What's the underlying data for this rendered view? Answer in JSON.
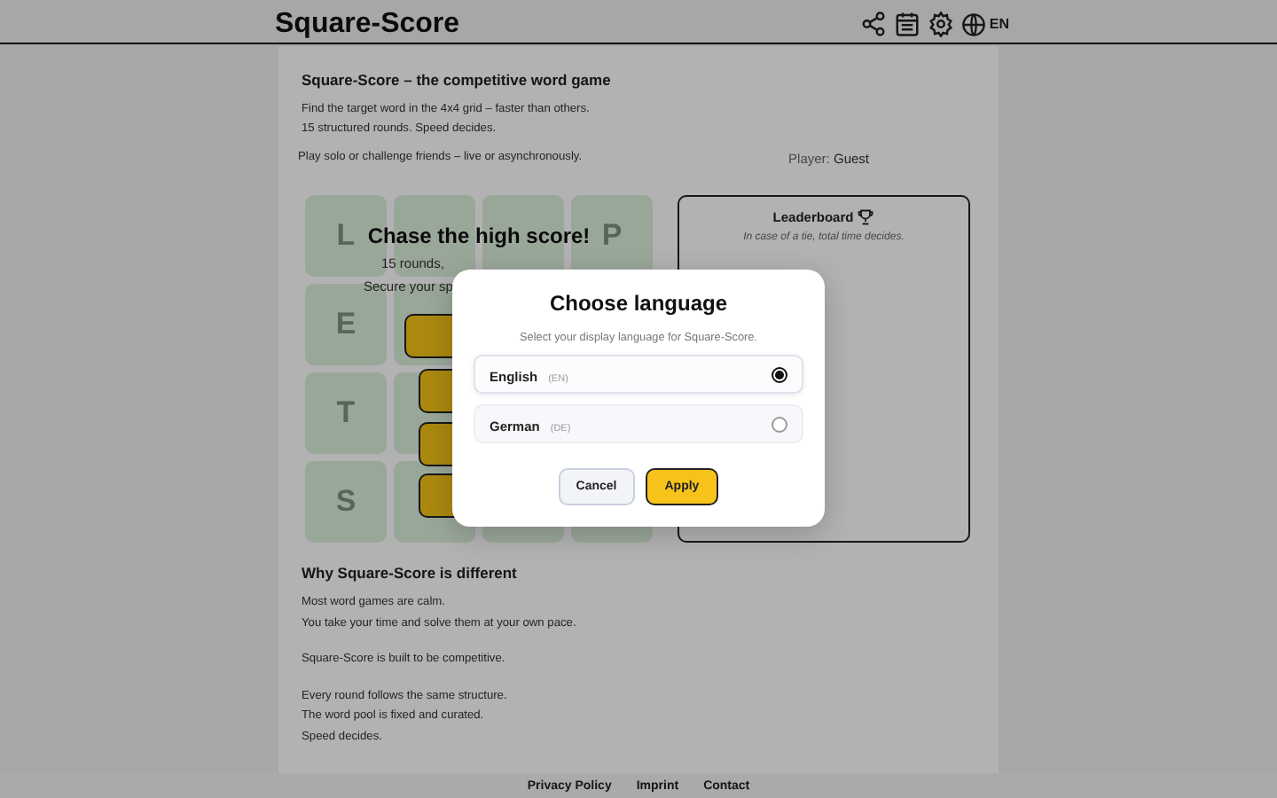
{
  "header": {
    "title": "Square-Score",
    "language_code": "EN"
  },
  "intro": {
    "heading": "Square-Score – the competitive word game",
    "lines": [
      "Find the target word in the 4x4 grid – faster than others.",
      "15 structured rounds. Speed decides."
    ],
    "play_note": "Play solo or challenge friends – live or asynchronously.",
    "player_label": "Player:",
    "player_name": "Guest"
  },
  "game": {
    "tile_rows": [
      [
        {
          "kind": "letter",
          "letter": "L"
        },
        {
          "kind": "blank"
        },
        {
          "kind": "blank"
        },
        {
          "kind": "letter",
          "letter": "P"
        }
      ],
      [
        {
          "kind": "letter",
          "letter": "E"
        },
        {
          "kind": "blank"
        }
      ],
      [
        {
          "kind": "letter",
          "letter": "T"
        },
        {
          "kind": "blank"
        }
      ],
      [
        {
          "kind": "letter",
          "letter": "S"
        },
        {
          "kind": "blank"
        },
        {
          "kind": "blank"
        },
        {
          "kind": "blank"
        }
      ]
    ],
    "headline": "Chase the high score!",
    "lines": [
      "15 rounds,",
      "Secure your sp"
    ]
  },
  "leaderboard": {
    "title": "Leaderboard",
    "note": "In case of a tie, total time decides."
  },
  "about": {
    "heading": "Why Square-Score is different",
    "paragraphs": [
      [
        "Most word games are calm.",
        "You take your time and solve them at your own pace."
      ],
      [
        "Square-Score is built to be competitive."
      ],
      [
        "Every round follows the same structure.",
        "The word pool is fixed and curated.",
        "Speed decides."
      ]
    ]
  },
  "footer": {
    "links": [
      "Privacy Policy",
      "Imprint",
      "Contact"
    ]
  },
  "modal": {
    "title": "Choose language",
    "subtitle": "Select your display language for Square-Score.",
    "options": [
      {
        "name": "English",
        "code": "(EN)",
        "selected": true
      },
      {
        "name": "German",
        "code": "(DE)",
        "selected": false
      }
    ],
    "buttons": [
      {
        "label": "Cancel",
        "kind": "secondary"
      },
      {
        "label": "Apply",
        "kind": "primary"
      }
    ]
  }
}
